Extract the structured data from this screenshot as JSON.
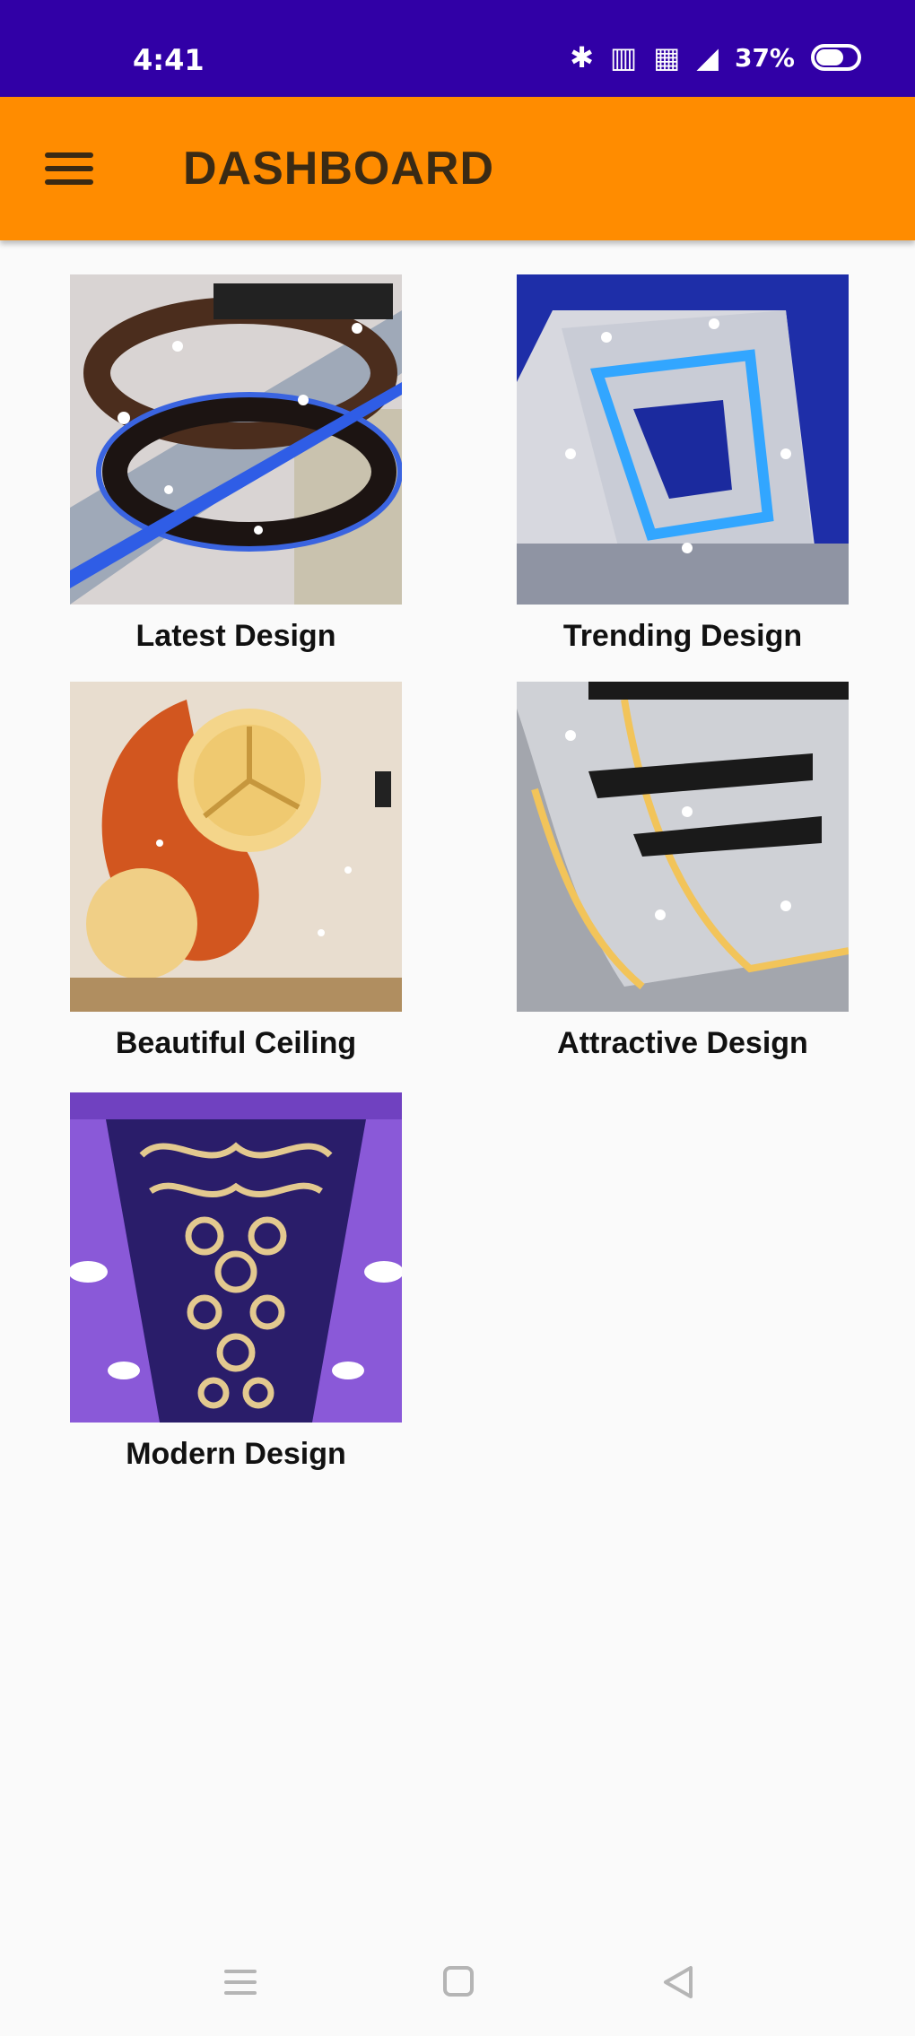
{
  "status_bar": {
    "time": "4:41",
    "battery": "37%",
    "icons": [
      "bluetooth-icon",
      "hd-signal-icon",
      "wifi-icon",
      "signal-icon",
      "battery-icon"
    ]
  },
  "app_bar": {
    "title": "DASHBOARD",
    "menu_icon": "menu-icon",
    "background": "#ff8c00"
  },
  "grid": {
    "items": [
      {
        "label": "Latest Design"
      },
      {
        "label": "Trending Design"
      },
      {
        "label": "Beautiful Ceiling"
      },
      {
        "label": "Attractive Design"
      },
      {
        "label": "Modern Design"
      }
    ]
  },
  "nav_bar": {
    "icons": [
      "recents-icon",
      "home-icon",
      "back-icon"
    ]
  },
  "colors": {
    "status_bar": "#3100a6",
    "app_bar": "#ff8c00",
    "background": "#fafafa"
  }
}
